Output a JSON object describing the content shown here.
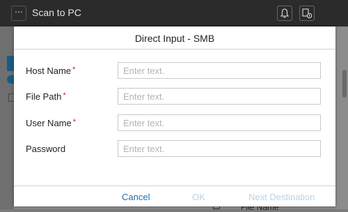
{
  "app": {
    "title": "Scan to PC",
    "menu_icon": "ellipsis-icon",
    "notification_icon": "bell-icon",
    "job_icon": "job-status-icon"
  },
  "background": {
    "bottom_item_label": "File Name"
  },
  "dialog": {
    "title": "Direct Input - SMB",
    "fields": [
      {
        "label": "Host Name",
        "required": "*",
        "placeholder": "Enter text.",
        "value": ""
      },
      {
        "label": "File Path",
        "required": "*",
        "placeholder": "Enter text.",
        "value": ""
      },
      {
        "label": "User Name",
        "required": "*",
        "placeholder": "Enter text.",
        "value": ""
      },
      {
        "label": "Password",
        "required": "",
        "placeholder": "Enter text.",
        "value": ""
      }
    ],
    "buttons": {
      "cancel": "Cancel",
      "ok": "OK",
      "next": "Next Destination"
    }
  },
  "colors": {
    "accent": "#1f6fb3",
    "disabled": "#b7d3ea",
    "required": "#d11a1a",
    "topbar": "#2b2b2b"
  }
}
